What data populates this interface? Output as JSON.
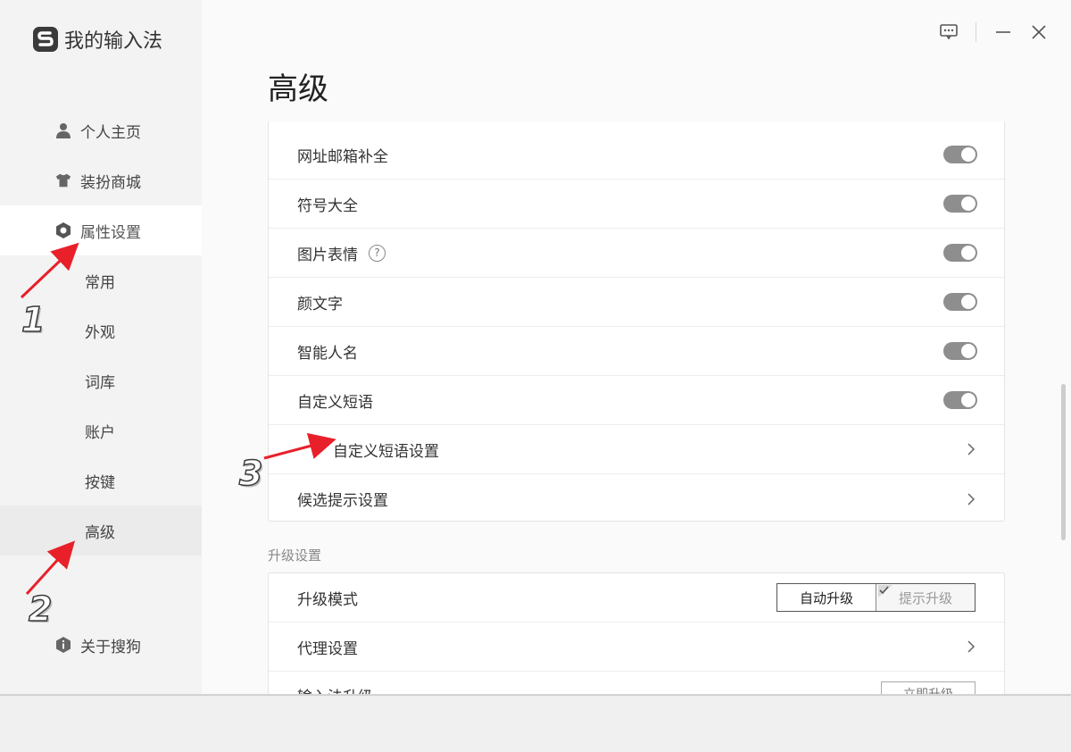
{
  "app": {
    "title": "我的输入法"
  },
  "main": {
    "title": "高级"
  },
  "sidebar": {
    "items": [
      {
        "label": "个人主页",
        "icon": "user-icon"
      },
      {
        "label": "装扮商城",
        "icon": "shirt-icon"
      },
      {
        "label": "属性设置",
        "icon": "gear-icon"
      },
      {
        "label": "关于搜狗",
        "icon": "info-icon"
      }
    ],
    "sub_items": [
      "常用",
      "外观",
      "词库",
      "账户",
      "按键",
      "高级"
    ]
  },
  "settings": {
    "rows": [
      {
        "label": "网址邮箱补全",
        "type": "toggle",
        "enabled": true
      },
      {
        "label": "符号大全",
        "type": "toggle",
        "enabled": true
      },
      {
        "label": "图片表情",
        "type": "toggle",
        "enabled": true,
        "help": "?"
      },
      {
        "label": "颜文字",
        "type": "toggle",
        "enabled": true
      },
      {
        "label": "智能人名",
        "type": "toggle",
        "enabled": true
      },
      {
        "label": "自定义短语",
        "type": "toggle",
        "enabled": true
      },
      {
        "label": "自定义短语设置",
        "type": "link"
      },
      {
        "label": "候选提示设置",
        "type": "link"
      }
    ]
  },
  "upgrade": {
    "section_label": "升级设置",
    "mode_label": "升级模式",
    "mode_options": [
      "自动升级",
      "提示升级"
    ],
    "mode_selected": "自动升级",
    "proxy_label": "代理设置",
    "ime_upgrade_label": "输入法升级",
    "ime_upgrade_button": "立即升级"
  },
  "annotations": [
    "1",
    "2",
    "3"
  ],
  "colors": {
    "annotation_arrow": "#e8202a",
    "toggle_on": "#8e8e8e"
  }
}
